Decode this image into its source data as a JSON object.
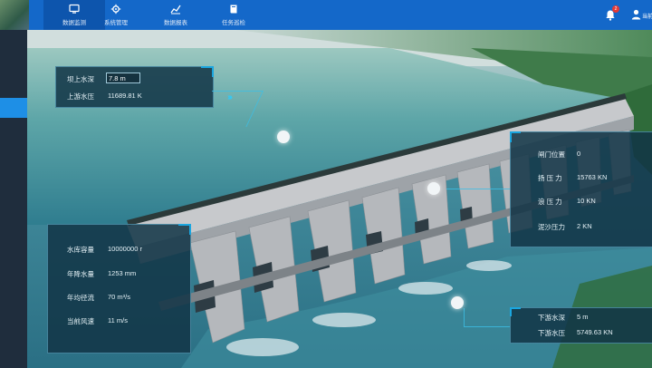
{
  "nav": {
    "tabs": [
      {
        "label": "数据监测",
        "icon": "monitor-icon",
        "active": true
      },
      {
        "label": "系统管理",
        "icon": "settings-gear-icon",
        "active": false
      },
      {
        "label": "数据报表",
        "icon": "line-chart-icon",
        "active": false
      },
      {
        "label": "任务巡检",
        "icon": "book-icon",
        "active": false
      }
    ],
    "notification_count": "2",
    "user_label": "当前"
  },
  "upstream_panel": {
    "water_depth_label": "坝上水深",
    "water_depth_value": "7.8 m",
    "pressure_label": "上游水压",
    "pressure_value": "11689.81 K"
  },
  "gate_panel": {
    "rows": [
      {
        "label": "闸门位置",
        "value": "0"
      },
      {
        "label": "扬 压 力",
        "value": "15763 KN"
      },
      {
        "label": "浪 压 力",
        "value": "10 KN"
      },
      {
        "label": "泥沙压力",
        "value": "2 KN"
      }
    ]
  },
  "reservoir_panel": {
    "rows": [
      {
        "label": "水库容量",
        "value": "10000000 r"
      },
      {
        "label": "年降水量",
        "value": "1253 mm"
      },
      {
        "label": "年均径流",
        "value": "70 m³/s"
      },
      {
        "label": "当前风速",
        "value": "11 m/s"
      }
    ]
  },
  "downstream_panel": {
    "water_depth_label": "下游水深",
    "water_depth_value": "5 m",
    "pressure_label": "下游水压",
    "pressure_value": "5749.63 KN"
  },
  "colors": {
    "topbar": "#1468c9",
    "sidebar": "#1f2d3d",
    "accent": "#1e8fe6",
    "panel_bg": "#123446"
  }
}
